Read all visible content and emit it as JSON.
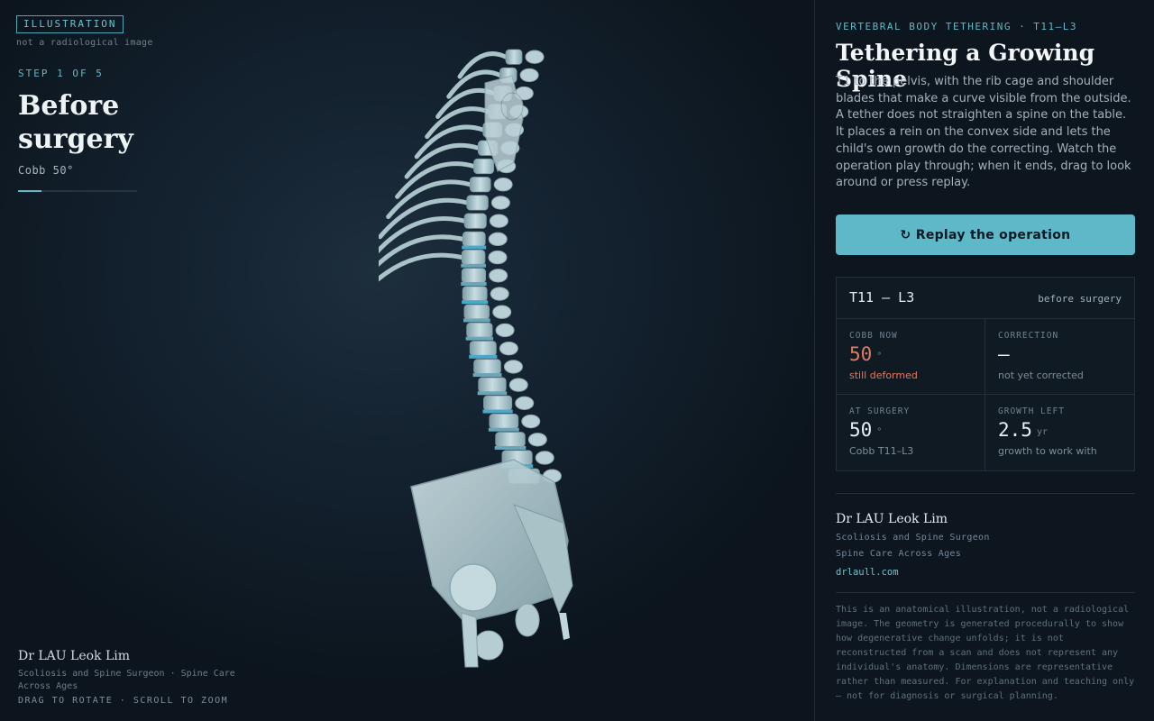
{
  "viewport": {
    "badge": "ILLUSTRATION",
    "badge_sub": "not a radiological image",
    "step": "STEP 1 OF 5",
    "stage_title": "Before surgery",
    "stage_cobb": "Cobb 50°",
    "progress_fraction": 0.2,
    "author": "Dr LAU Leok Lim",
    "author_role": "Scoliosis and Spine Surgeon · Spine Care Across Ages",
    "hint": "DRAG TO ROTATE · SCROLL TO ZOOM"
  },
  "panel": {
    "kicker": "VERTEBRAL BODY TETHERING · T11–L3",
    "title": "Tethering a Growing Spine",
    "description": "T1 to the pelvis, with the rib cage and shoulder blades that make a curve visible from the outside. A tether does not straighten a spine on the table. It places a rein on the convex side and lets the child's own growth do the correcting. Watch the operation play through; when it ends, drag to look around or press replay.",
    "replay_label": "↻ Replay the operation",
    "card": {
      "range": "T11 – L3",
      "state": "before surgery",
      "cobb_now": {
        "label": "COBB NOW",
        "value": "50",
        "unit": "°",
        "note": "still deformed"
      },
      "correction": {
        "label": "CORRECTION",
        "value": "—",
        "note": "not yet corrected"
      },
      "at_surgery": {
        "label": "AT SURGERY",
        "value": "50",
        "unit": "°",
        "note": "Cobb T11–L3"
      },
      "growth_left": {
        "label": "GROWTH LEFT",
        "value": "2.5",
        "unit": "yr",
        "note": "growth to work with"
      }
    },
    "author": "Dr LAU Leok Lim",
    "role": "Scoliosis and Spine Surgeon",
    "org": "Spine Care Across Ages",
    "link": "drlaull.com",
    "disclaimer": "This is an anatomical illustration, not a radiological image. The geometry is generated procedurally to show how degenerative change unfolds; it is not reconstructed from a scan and does not represent any individual's anatomy. Dimensions are representative rather than measured. For explanation and teaching only — not for diagnosis or surgical planning."
  },
  "colors": {
    "accent": "#5eb8c8",
    "deformity": "#e07b63",
    "bone": "#b8cfd5",
    "tether": "#4aa8c8"
  }
}
